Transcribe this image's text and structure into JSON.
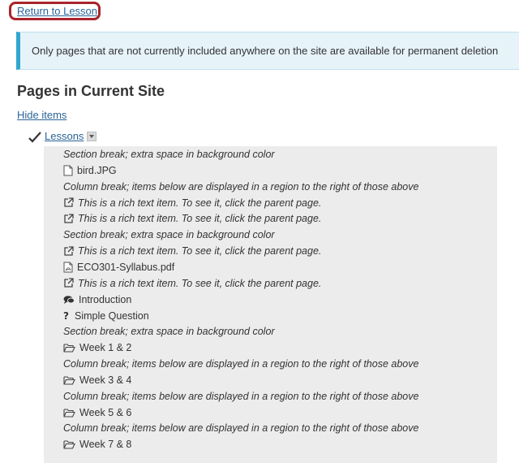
{
  "return_link": "Return to Lesson",
  "notice": "Only pages that are not currently included anywhere on the site are available for permanent deletion",
  "page_title": "Pages in Current Site",
  "hide_items": "Hide items",
  "lessons_label": "Lessons",
  "items": [
    {
      "icon": "none",
      "italic": true,
      "text": "Section break; extra space in background color"
    },
    {
      "icon": "file-icon",
      "italic": false,
      "text": "bird.JPG"
    },
    {
      "icon": "none",
      "italic": true,
      "text": "Column break; items below are displayed in a region to the right of those above"
    },
    {
      "icon": "external-link-icon",
      "italic": true,
      "text": "This is a rich text item. To see it, click the parent page."
    },
    {
      "icon": "external-link-icon",
      "italic": true,
      "text": "This is a rich text item. To see it, click the parent page."
    },
    {
      "icon": "none",
      "italic": true,
      "text": "Section break; extra space in background color"
    },
    {
      "icon": "external-link-icon",
      "italic": true,
      "text": "This is a rich text item. To see it, click the parent page."
    },
    {
      "icon": "pdf-file-icon",
      "italic": false,
      "text": "ECO301-Syllabus.pdf"
    },
    {
      "icon": "external-link-icon",
      "italic": true,
      "text": "This is a rich text item. To see it, click the parent page."
    },
    {
      "icon": "chat-bubbles-icon",
      "italic": false,
      "text": "Introduction"
    },
    {
      "icon": "question-icon",
      "italic": false,
      "text": "Simple Question"
    },
    {
      "icon": "none",
      "italic": true,
      "text": "Section break; extra space in background color"
    },
    {
      "icon": "folder-open-icon",
      "italic": false,
      "text": "Week 1 & 2"
    },
    {
      "icon": "none",
      "italic": true,
      "text": "Column break; items below are displayed in a region to the right of those above"
    },
    {
      "icon": "folder-open-icon",
      "italic": false,
      "text": "Week 3 & 4"
    },
    {
      "icon": "none",
      "italic": true,
      "text": "Column break; items below are displayed in a region to the right of those above"
    },
    {
      "icon": "folder-open-icon",
      "italic": false,
      "text": "Week 5 & 6"
    },
    {
      "icon": "none",
      "italic": true,
      "text": "Column break; items below are displayed in a region to the right of those above"
    },
    {
      "icon": "folder-open-icon",
      "italic": false,
      "text": "Week 7 & 8"
    }
  ],
  "colors": {
    "link": "#2a6496",
    "highlight_border": "#a8252b",
    "info_bg": "#e6f3f9",
    "info_accent": "#31a7cf",
    "panel_bg": "#ececec"
  }
}
